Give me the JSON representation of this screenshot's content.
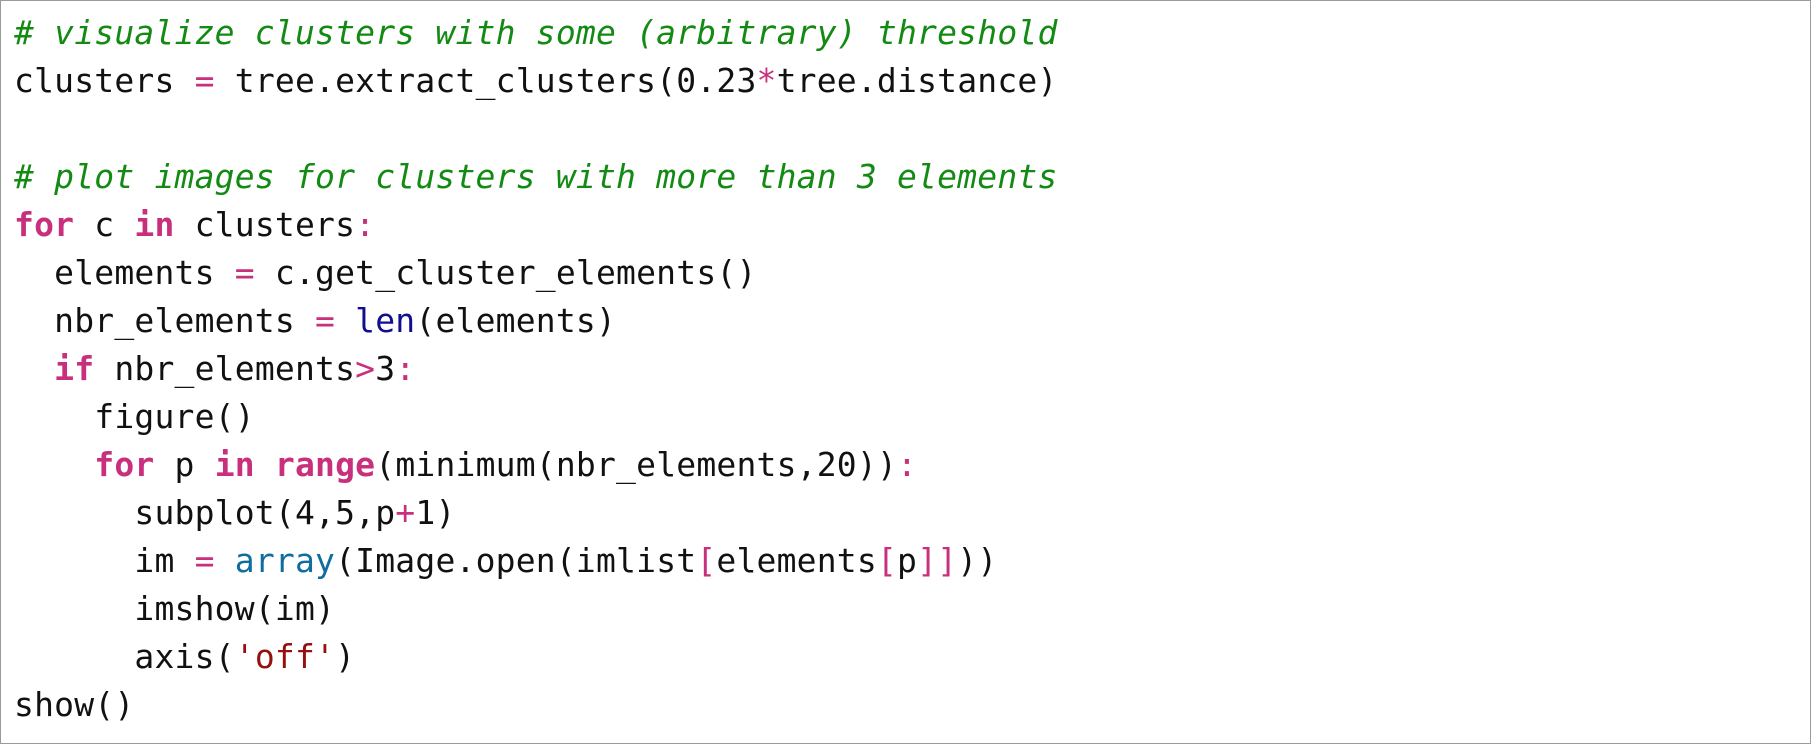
{
  "colors": {
    "comment": "#138a13",
    "keyword": "#c8307d",
    "operator": "#c8307d",
    "builtin": "#10108f",
    "function": "#0f6e9e",
    "string": "#961010",
    "text": "#111111",
    "border": "#9a9a9a"
  },
  "code": {
    "lines": [
      {
        "tokens": [
          {
            "t": "# visualize clusters with some (arbitrary) threshold",
            "k": "cmt"
          }
        ]
      },
      {
        "tokens": [
          {
            "t": "clusters ",
            "k": "txt"
          },
          {
            "t": "=",
            "k": "op"
          },
          {
            "t": " tree.extract_clusters(0.23",
            "k": "txt"
          },
          {
            "t": "*",
            "k": "op"
          },
          {
            "t": "tree.distance)",
            "k": "txt"
          }
        ]
      },
      {
        "tokens": []
      },
      {
        "tokens": [
          {
            "t": "# plot images for clusters with more than 3 elements",
            "k": "cmt"
          }
        ]
      },
      {
        "tokens": [
          {
            "t": "for",
            "k": "kw"
          },
          {
            "t": " c ",
            "k": "txt"
          },
          {
            "t": "in",
            "k": "kw"
          },
          {
            "t": " clusters",
            "k": "txt"
          },
          {
            "t": ":",
            "k": "op"
          }
        ]
      },
      {
        "tokens": [
          {
            "t": "  elements ",
            "k": "txt"
          },
          {
            "t": "=",
            "k": "op"
          },
          {
            "t": " c.get_cluster_elements()",
            "k": "txt"
          }
        ]
      },
      {
        "tokens": [
          {
            "t": "  nbr_elements ",
            "k": "txt"
          },
          {
            "t": "=",
            "k": "op"
          },
          {
            "t": " ",
            "k": "txt"
          },
          {
            "t": "len",
            "k": "bi"
          },
          {
            "t": "(elements)",
            "k": "txt"
          }
        ]
      },
      {
        "tokens": [
          {
            "t": "  ",
            "k": "txt"
          },
          {
            "t": "if",
            "k": "kw"
          },
          {
            "t": " nbr_elements",
            "k": "txt"
          },
          {
            "t": ">",
            "k": "op"
          },
          {
            "t": "3",
            "k": "txt"
          },
          {
            "t": ":",
            "k": "op"
          }
        ]
      },
      {
        "tokens": [
          {
            "t": "    figure()",
            "k": "txt"
          }
        ]
      },
      {
        "tokens": [
          {
            "t": "    ",
            "k": "txt"
          },
          {
            "t": "for",
            "k": "kw"
          },
          {
            "t": " p ",
            "k": "txt"
          },
          {
            "t": "in",
            "k": "kw"
          },
          {
            "t": " ",
            "k": "txt"
          },
          {
            "t": "range",
            "k": "kw"
          },
          {
            "t": "(minimum(nbr_elements,20))",
            "k": "txt"
          },
          {
            "t": ":",
            "k": "op"
          }
        ]
      },
      {
        "tokens": [
          {
            "t": "      subplot(4,5,p",
            "k": "txt"
          },
          {
            "t": "+",
            "k": "op"
          },
          {
            "t": "1)",
            "k": "txt"
          }
        ]
      },
      {
        "tokens": [
          {
            "t": "      im ",
            "k": "txt"
          },
          {
            "t": "=",
            "k": "op"
          },
          {
            "t": " ",
            "k": "txt"
          },
          {
            "t": "array",
            "k": "fn"
          },
          {
            "t": "(Image.open(imlist",
            "k": "txt"
          },
          {
            "t": "[",
            "k": "op"
          },
          {
            "t": "elements",
            "k": "txt"
          },
          {
            "t": "[",
            "k": "op"
          },
          {
            "t": "p",
            "k": "txt"
          },
          {
            "t": "]]",
            "k": "op"
          },
          {
            "t": "))",
            "k": "txt"
          }
        ]
      },
      {
        "tokens": [
          {
            "t": "      imshow(im)",
            "k": "txt"
          }
        ]
      },
      {
        "tokens": [
          {
            "t": "      axis(",
            "k": "txt"
          },
          {
            "t": "'off'",
            "k": "str"
          },
          {
            "t": ")",
            "k": "txt"
          }
        ]
      },
      {
        "tokens": [
          {
            "t": "show()",
            "k": "txt"
          }
        ]
      }
    ]
  }
}
